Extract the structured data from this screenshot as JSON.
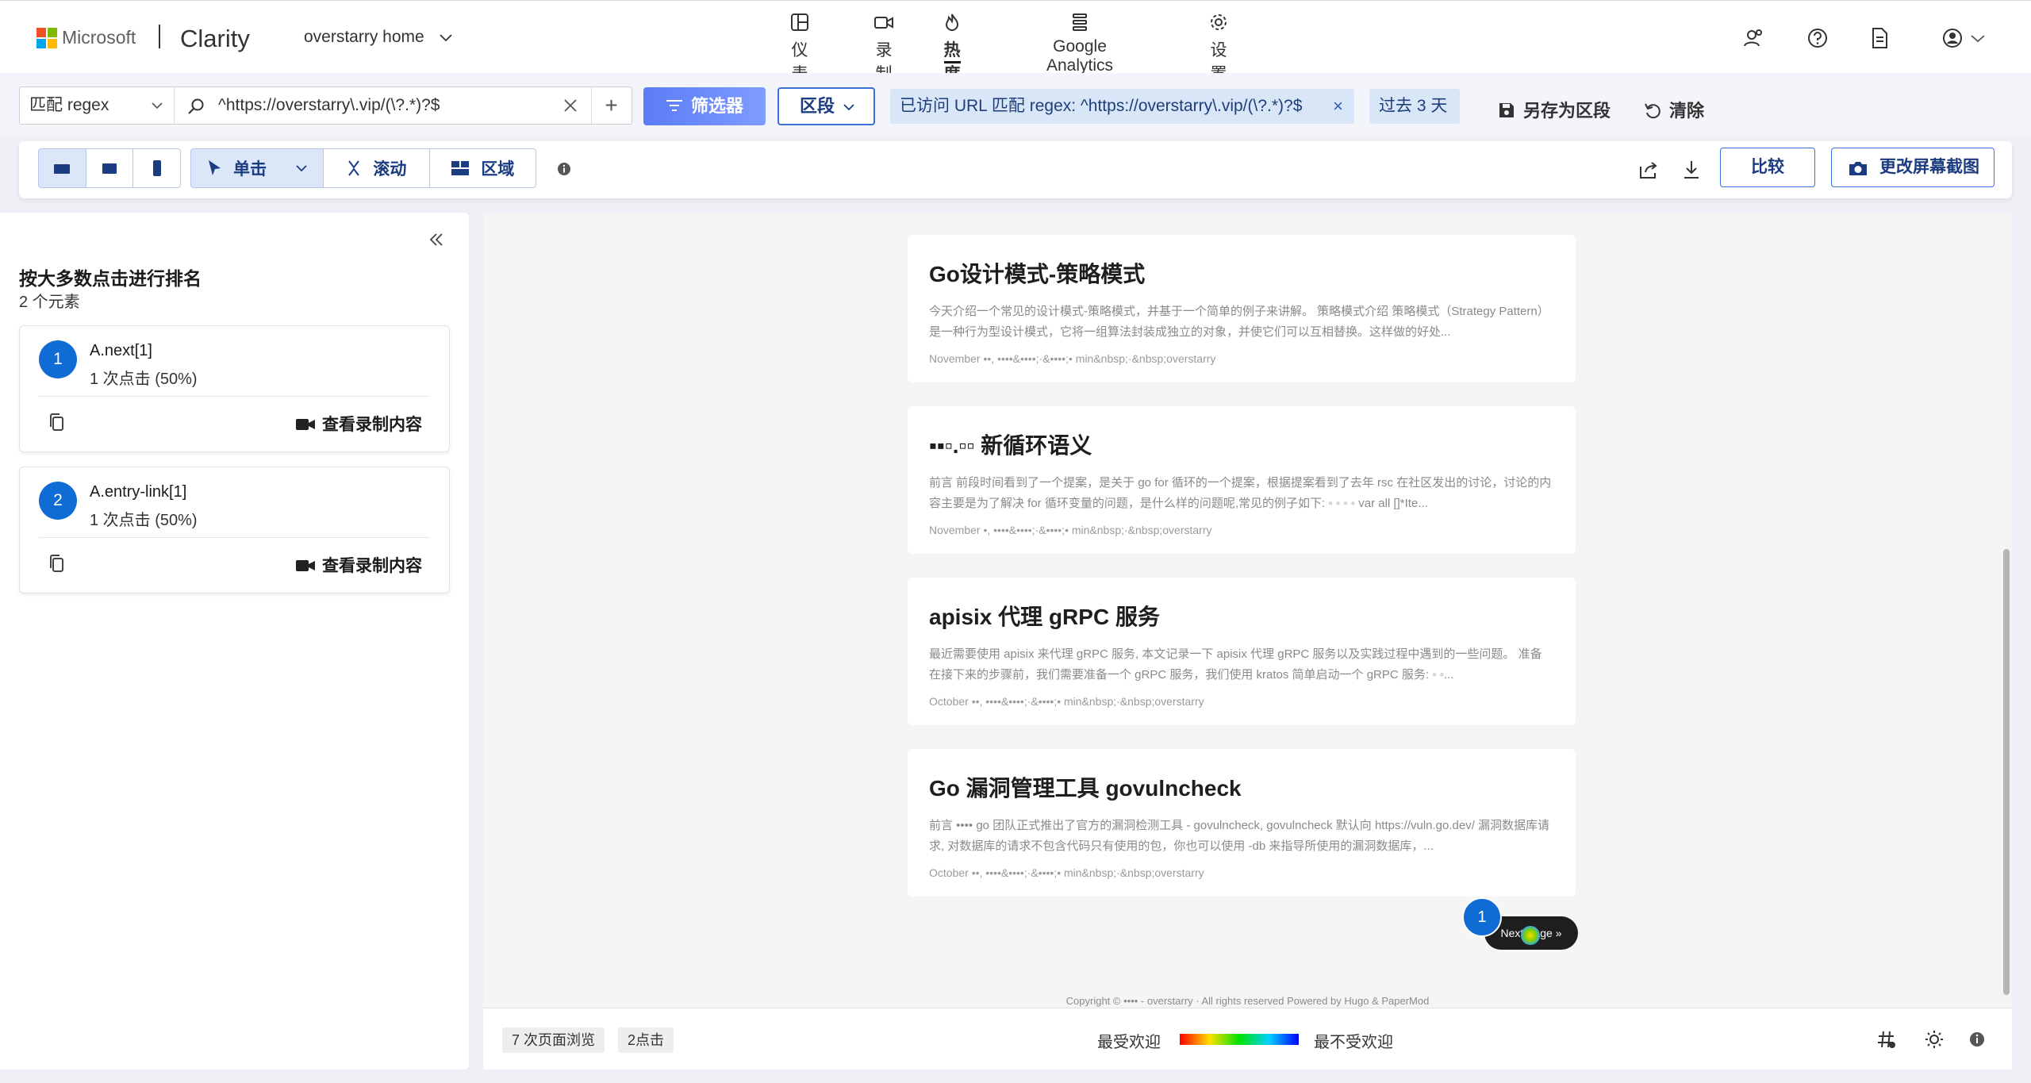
{
  "header": {
    "brand": "Microsoft",
    "product": "Clarity",
    "project": "overstarry home",
    "nav": [
      {
        "label": "仪表板",
        "icon": "dashboard-icon"
      },
      {
        "label": "录制",
        "icon": "video-camera-icon"
      },
      {
        "label": "热度地图",
        "icon": "flame-icon",
        "active": true
      },
      {
        "label": "Google Analytics",
        "icon": "analytics-icon"
      },
      {
        "label": "设置",
        "icon": "gear-icon"
      }
    ],
    "right_icons": [
      "people-icon",
      "help-icon",
      "document-icon",
      "account-icon"
    ]
  },
  "filters": {
    "match_type": "匹配 regex",
    "url_value": "^https://overstarry\\.vip/(\\?.*)?$",
    "add_label": "+",
    "filter_button": "筛选器",
    "segment_button": "区段",
    "url_chip": "已访问 URL 匹配 regex: ^https://overstarry\\.vip/(\\?.*)?$",
    "url_chip_close": "×",
    "date_chip": "过去 3 天",
    "save_segment": "另存为区段",
    "clear": "清除"
  },
  "toolbar": {
    "devices": [
      "desktop-icon",
      "tablet-icon",
      "mobile-icon"
    ],
    "modes": [
      {
        "label": "单击",
        "icon": "cursor-icon",
        "active": true
      },
      {
        "label": "滚动",
        "icon": "scroll-icon"
      },
      {
        "label": "区域",
        "icon": "area-icon"
      }
    ],
    "compare": "比较",
    "change_screenshot": "更改屏幕截图"
  },
  "sidebar": {
    "title": "按大多数点击进行排名",
    "subtitle": "2 个元素",
    "items": [
      {
        "rank": "1",
        "name": "A.next[1]",
        "clicks": "1 次点击 (50%)",
        "view": "查看录制内容"
      },
      {
        "rank": "2",
        "name": "A.entry-link[1]",
        "clicks": "1 次点击 (50%)",
        "view": "查看录制内容"
      }
    ]
  },
  "heatmap": {
    "posts": [
      {
        "title": "Go设计模式-策略模式",
        "summary": "今天介绍一个常见的设计模式-策略模式，并基于一个简单的例子来讲解。 策略模式介绍 策略模式（Strategy Pattern）是一种行为型设计模式，它将一组算法封装成独立的对象，并使它们可以互相替换。这样做的好处...",
        "meta": "November ••, ••••&••••;·&••••;• min&nbsp;·&nbsp;overstarry"
      },
      {
        "title": "▪▪▫.▫▫ 新循环语义",
        "summary": "前言 前段时间看到了一个提案，是关于 go for 循环的一个提案，根据提案看到了去年 rsc 在社区发出的讨论，讨论的内容主要是为了解决 for 循环变量的问题，是什么样的问题呢,常见的例子如下: ◦ ◦ ◦ ◦ var all []*Ite...",
        "meta": "November •, ••••&••••;·&••••;• min&nbsp;·&nbsp;overstarry"
      },
      {
        "title": "apisix 代理 gRPC 服务",
        "summary": "最近需要使用 apisix 来代理 gRPC 服务, 本文记录一下 apisix 代理 gRPC 服务以及实践过程中遇到的一些问题。 准备 在接下来的步骤前，我们需要准备一个 gRPC 服务，我们使用 kratos 简单启动一个 gRPC 服务: ◦ ◦...",
        "meta": "October ••, ••••&••••;·&••••;• min&nbsp;·&nbsp;overstarry"
      },
      {
        "title": "Go 漏洞管理工具 govulncheck",
        "summary": "前言 •••• go 团队正式推出了官方的漏洞检测工具 - govulncheck, govulncheck 默认向 https://vuln.go.dev/ 漏洞数据库请求, 对数据库的请求不包含代码只有使用的包，你也可以使用 -db 来指导所使用的漏洞数据库，...",
        "meta": "October ••, ••••&••••;·&••••;• min&nbsp;·&nbsp;overstarry"
      }
    ],
    "next_page": "Next Page »",
    "click_badge": "1",
    "copyright": "Copyright © •••• - overstarry · All rights reserved  Powered by Hugo & PaperMod"
  },
  "bottom": {
    "page_views": "7 次页面浏览",
    "clicks": "2点击",
    "most_popular": "最受欢迎",
    "least_popular": "最不受欢迎"
  },
  "colors": {
    "accent": "#0f6cd4",
    "filter_gradient_start": "#5b7cf5",
    "chip_bg": "#d9e6f8"
  }
}
